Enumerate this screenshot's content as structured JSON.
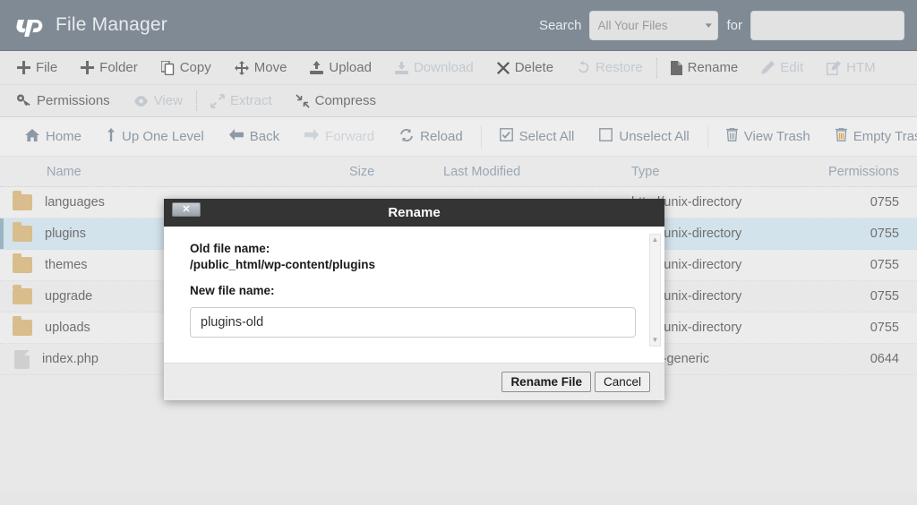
{
  "header": {
    "logo_icon": "cpanel-logo-icon",
    "title": "File Manager",
    "search_label": "Search",
    "search_scope_value": "All Your Files",
    "for_label": "for",
    "search_value": "",
    "search_placeholder": ""
  },
  "toolbar_row1": [
    {
      "label": "File",
      "icon": "plus-icon",
      "disabled": false
    },
    {
      "label": "Folder",
      "icon": "plus-icon",
      "disabled": false
    },
    {
      "label": "Copy",
      "icon": "copy-icon",
      "disabled": false
    },
    {
      "label": "Move",
      "icon": "move-arrows-icon",
      "disabled": false
    },
    {
      "label": "Upload",
      "icon": "upload-icon",
      "disabled": false
    },
    {
      "label": "Download",
      "icon": "download-icon",
      "disabled": true
    },
    {
      "label": "Delete",
      "icon": "x-mark-icon",
      "disabled": false
    },
    {
      "label": "Restore",
      "icon": "undo-icon",
      "disabled": true
    },
    {
      "label": "Rename",
      "icon": "file-icon",
      "disabled": false
    },
    {
      "label": "Edit",
      "icon": "pencil-icon",
      "disabled": true
    },
    {
      "label": "HTM",
      "icon": "html-editor-icon",
      "disabled": true
    }
  ],
  "toolbar_row2": [
    {
      "label": "Permissions",
      "icon": "key-icon",
      "disabled": false
    },
    {
      "label": "View",
      "icon": "eye-icon",
      "disabled": true
    },
    {
      "label": "Extract",
      "icon": "extract-arrows-icon",
      "disabled": true
    },
    {
      "label": "Compress",
      "icon": "compress-arrows-icon",
      "disabled": false
    }
  ],
  "navbar": [
    {
      "label": "Home",
      "icon": "home-icon",
      "disabled": false
    },
    {
      "label": "Up One Level",
      "icon": "up-arrow-icon",
      "disabled": false
    },
    {
      "label": "Back",
      "icon": "left-arrow-icon",
      "disabled": false
    },
    {
      "label": "Forward",
      "icon": "right-arrow-icon",
      "disabled": true
    },
    {
      "label": "Reload",
      "icon": "reload-icon",
      "disabled": false
    },
    {
      "label": "Select All",
      "icon": "checked-box-icon",
      "disabled": false
    },
    {
      "label": "Unselect All",
      "icon": "empty-box-icon",
      "disabled": false
    },
    {
      "label": "View Trash",
      "icon": "trash-icon",
      "disabled": false
    },
    {
      "label": "Empty Trash",
      "icon": "trash-orange-icon",
      "disabled": false
    }
  ],
  "table": {
    "columns": [
      "Name",
      "Size",
      "Last Modified",
      "Type",
      "Permissions"
    ],
    "rows": [
      {
        "name": "languages",
        "icon": "folder-icon",
        "size": "",
        "modified": "",
        "type": "httpd/unix-directory",
        "permissions": "0755",
        "selected": false
      },
      {
        "name": "plugins",
        "icon": "folder-icon",
        "size": "",
        "modified": "",
        "type": "httpd/unix-directory",
        "permissions": "0755",
        "selected": true
      },
      {
        "name": "themes",
        "icon": "folder-icon",
        "size": "",
        "modified": "",
        "type": "httpd/unix-directory",
        "permissions": "0755",
        "selected": false
      },
      {
        "name": "upgrade",
        "icon": "folder-icon",
        "size": "",
        "modified": "",
        "type": "httpd/unix-directory",
        "permissions": "0755",
        "selected": false
      },
      {
        "name": "uploads",
        "icon": "folder-icon",
        "size": "",
        "modified": "",
        "type": "httpd/unix-directory",
        "permissions": "0755",
        "selected": false
      },
      {
        "name": "index.php",
        "icon": "file-icon",
        "size": "",
        "modified": "",
        "type": "text/x-generic",
        "permissions": "0644",
        "selected": false
      }
    ]
  },
  "modal": {
    "title": "Rename",
    "close_icon": "close-x-icon",
    "old_file_label": "Old file name:",
    "old_file_value": "/public_html/wp-content/plugins",
    "new_file_label": "New file name:",
    "new_file_value": "plugins-old",
    "new_file_placeholder": "",
    "confirm_label": "Rename File",
    "cancel_label": "Cancel",
    "scroll_up_icon": "scroll-up-arrow-icon",
    "scroll_down_icon": "scroll-down-arrow-icon"
  },
  "colors": {
    "header_bg": "#7f8a94",
    "toolbar_bg": "#e7e7e7",
    "selection_bg": "#d3e3ec",
    "folder": "#d9bd8c",
    "modal_title_bg": "#343434",
    "trash_orange": "#e0a349"
  }
}
